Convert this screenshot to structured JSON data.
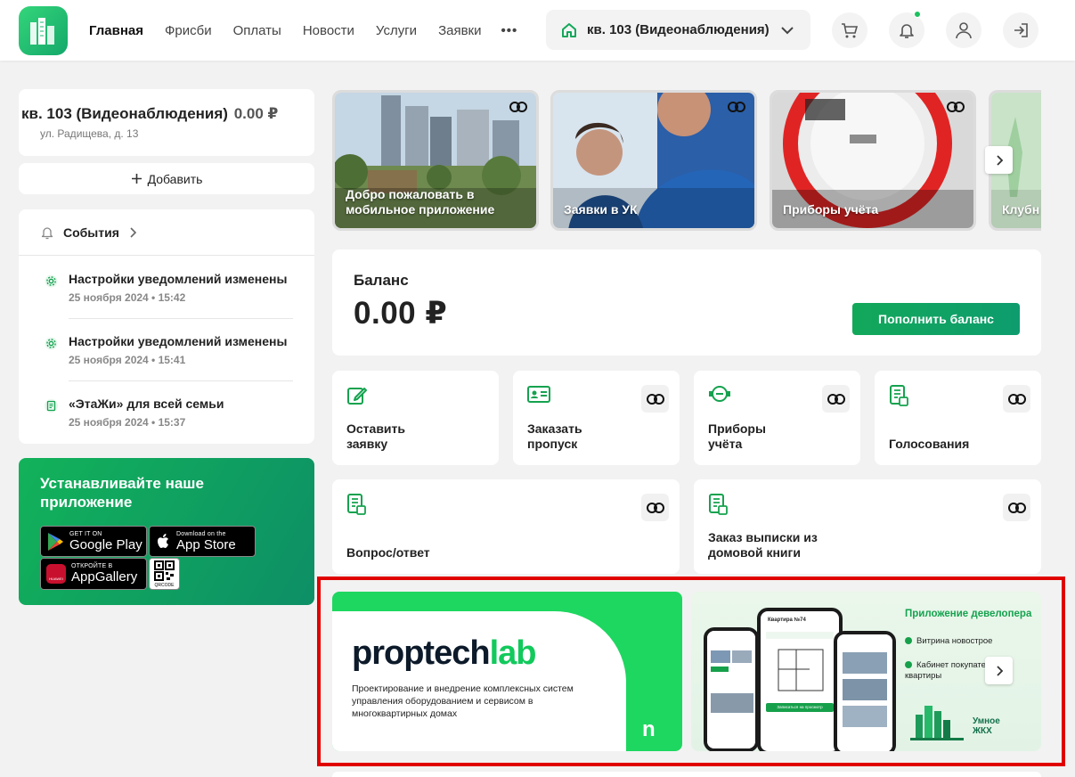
{
  "header": {
    "nav": [
      "Главная",
      "Фрисби",
      "Оплаты",
      "Новости",
      "Услуги",
      "Заявки"
    ],
    "more": "•••",
    "apartment_selector": "кв. 103 (Видеонаблюдения)"
  },
  "account": {
    "name": "кв. 103 (Видеонаблюдения)",
    "balance": "0.00 ₽",
    "address": "ул. Радищева, д. 13",
    "add_label": "Добавить"
  },
  "events": {
    "title": "События",
    "items": [
      {
        "title": "Настройки уведомлений изменены",
        "date": "25 ноября 2024 • 15:42",
        "icon": "gear-icon"
      },
      {
        "title": "Настройки уведомлений изменены",
        "date": "25 ноября 2024 • 15:41",
        "icon": "gear-icon"
      },
      {
        "title": "«ЭтаЖи» для всей семьи",
        "date": "25 ноября 2024 • 15:37",
        "icon": "document-icon"
      }
    ]
  },
  "app_promo": {
    "title": "Устанавливайте наше приложение",
    "google_small": "GET IT ON",
    "google_big": "Google Play",
    "apple_small": "Download on the",
    "apple_big": "App Store",
    "huawei_small": "ОТКРОЙТЕ В",
    "huawei_big": "AppGallery",
    "huawei_logo": "HUAWEI",
    "qr_label": "QRCODE"
  },
  "stories": [
    {
      "label": "Добро пожаловать в мобильное приложение"
    },
    {
      "label": "Заявки в УК"
    },
    {
      "label": "Приборы учёта"
    },
    {
      "label": "Клубн"
    }
  ],
  "balance": {
    "title": "Баланс",
    "value": "0.00 ₽",
    "button": "Пополнить баланс"
  },
  "tiles": [
    {
      "label": "Оставить заявку",
      "icon": "edit-icon",
      "link": false
    },
    {
      "label": "Заказать пропуск",
      "icon": "id-card-icon",
      "link": true
    },
    {
      "label": "Приборы учёта",
      "icon": "meter-icon",
      "link": true
    },
    {
      "label": "Голосования",
      "icon": "document-icon",
      "link": true
    },
    {
      "label": "Вопрос/ответ",
      "icon": "document-icon",
      "link": true
    },
    {
      "label": "Заказ выписки из домовой книги",
      "icon": "document-icon",
      "link": true
    }
  ],
  "banner_left": {
    "brand_a": "proptech",
    "brand_b": "lab",
    "description": "Проектирование и внедрение комплексных систем управления оборудованием и сервисом в многоквартирных домах",
    "mark": "n"
  },
  "banner_right": {
    "title": "Приложение девелопера",
    "features": [
      "Витрина новострое",
      "Кабинет покупате квартиры"
    ],
    "phone_title": "Квартира №74",
    "phone_button": "Записаться на просмотр",
    "brand": "Умное ЖКХ"
  },
  "colors": {
    "accent": "#12a85a",
    "highlight_frame": "#e00000",
    "promo_bg": "#12b25a"
  }
}
